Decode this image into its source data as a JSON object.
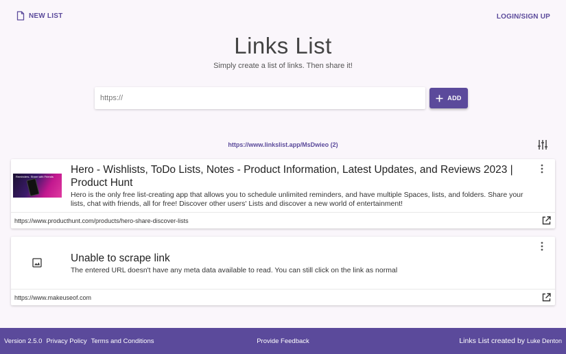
{
  "header": {
    "new_list_label": "NEW LIST",
    "login_label": "LOGIN/SIGN UP"
  },
  "hero": {
    "title": "Links List",
    "subtitle": "Simply create a list of links. Then share it!"
  },
  "input": {
    "placeholder": "https://",
    "value": "",
    "add_label": "ADD"
  },
  "share": {
    "link_text": "https://www.linkslist.app/MsDwieo (2)"
  },
  "cards": [
    {
      "title": "Hero - Wishlists, ToDo Lists, Notes - Product Information, Latest Updates, and Reviews 2023 | Product Hunt",
      "description": "Hero is the only free list-creating app that allows you to schedule unlimited reminders, and have multiple Spaces, lists, and folders. Share your lists, chat with friends, all for free! Discover other users' Lists and discover a new world of entertainment!",
      "url": "https://www.producthunt.com/products/hero-share-discover-lists",
      "thumb_text": "Reminders. Share with Friends"
    },
    {
      "title": "Unable to scrape link",
      "description": "The entered URL doesn't have any meta data available to read. You can still click on the link as normal",
      "url": "https://www.makeuseof.com"
    }
  ],
  "footer": {
    "version": "Version 2.5.0",
    "privacy": "Privacy Policy",
    "terms": "Terms and Conditions",
    "feedback": "Provide Feedback",
    "credit_prefix": "Links List created by",
    "credit_author": "Luke Denton"
  },
  "colors": {
    "primary": "#5b4a9b",
    "background": "#faf6fb"
  }
}
